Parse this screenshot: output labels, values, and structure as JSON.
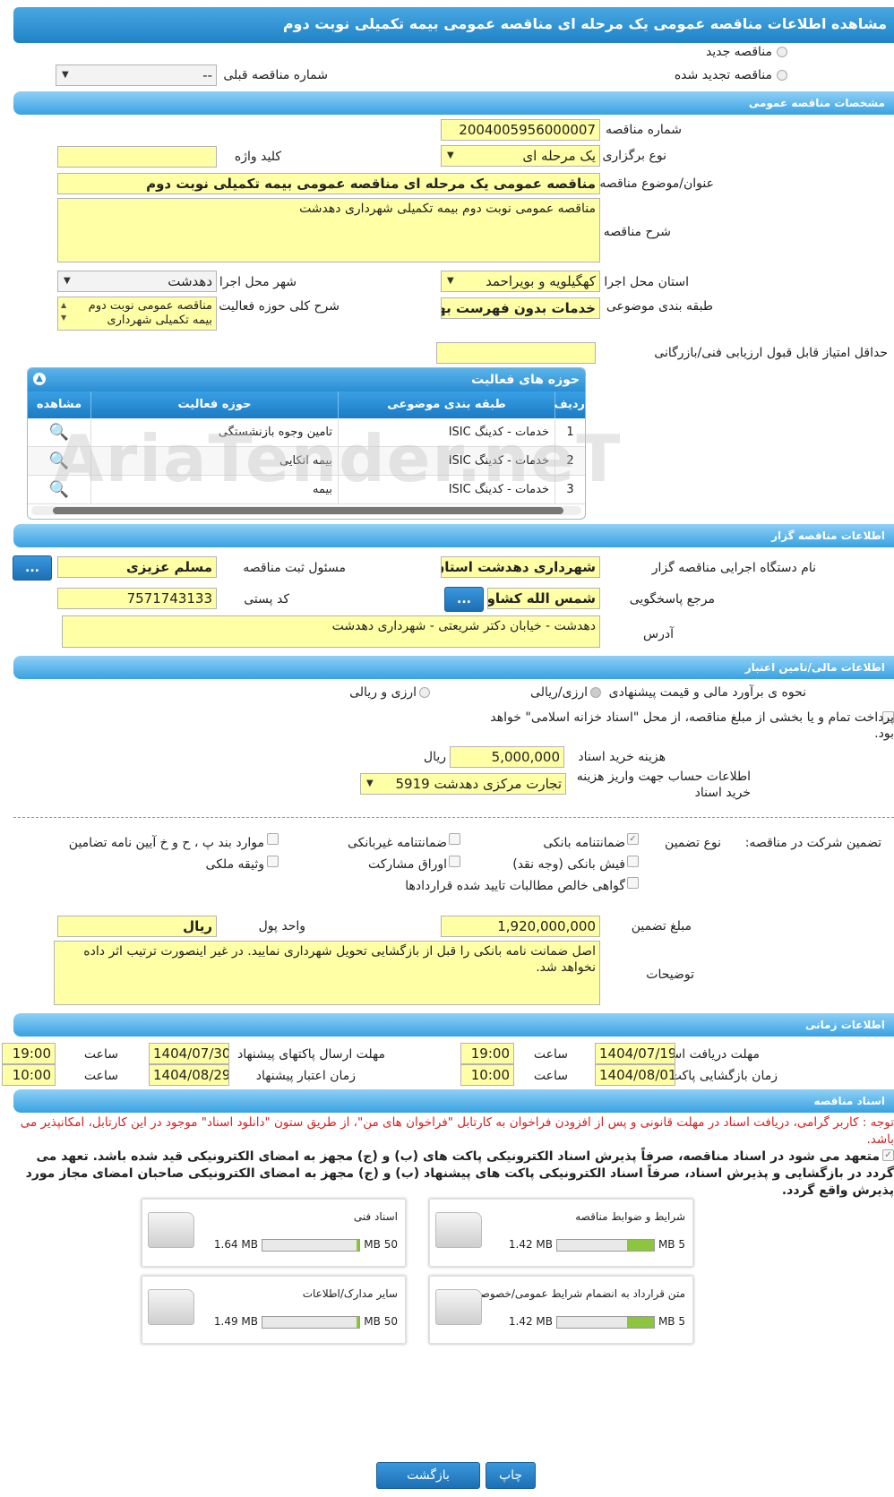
{
  "title": "مشاهده اطلاعات مناقصه عمومی یک مرحله ای مناقصه عمومی بیمه تکمیلی نوبت دوم",
  "top": {
    "new_tender": "مناقصه جدید",
    "renewed_tender": "مناقصه تجدید شده",
    "prev_number_label": "شماره مناقصه قبلی",
    "prev_number_value": "--"
  },
  "sections": {
    "general": "مشخصات مناقصه عمومی",
    "organizer": "اطلاعات مناقصه گزار",
    "finance": "اطلاعات مالی/تامین اعتبار",
    "timing": "اطلاعات زمانی",
    "documents": "اسناد مناقصه"
  },
  "general": {
    "number_label": "شماره مناقصه",
    "number_value": "2004005956000007",
    "type_label": "نوع برگزاری",
    "type_value": "یک مرحله ای",
    "keyword_label": "کلید واژه",
    "keyword_value": "",
    "subject_label": "عنوان/موضوع مناقصه",
    "subject_value": "مناقصه عمومی یک مرحله ای مناقصه عمومی بیمه تکمیلی نوبت دوم",
    "desc_label": "شرح مناقصه",
    "desc_value": "مناقصه عمومی نوبت دوم بیمه تکمیلی شهرداری دهدشت",
    "province_label": "استان محل اجرا",
    "province_value": "کهگیلویه و بویراحمد",
    "city_label": "شهر محل اجرا",
    "city_value": "دهدشت",
    "category_label": "طبقه بندی موضوعی",
    "category_value": "خدمات بدون فهرست بها",
    "activity_desc_label": "شرح کلی حوزه فعالیت",
    "activity_desc_value": "مناقصه عمومی نوبت دوم بیمه تکمیلی شهرداری",
    "min_score_label": "حداقل امتیاز قابل قبول ارزیابی فنی/بازرگانی",
    "min_score_value": ""
  },
  "activity_grid": {
    "title": "حوزه های فعالیت",
    "headers": [
      "ردیف",
      "طبقه بندی موضوعی",
      "حوزه فعالیت",
      "مشاهده"
    ],
    "rows": [
      [
        "1",
        "خدمات - کدینگ ISIC",
        "تامین وجوه بازنشستگی"
      ],
      [
        "2",
        "خدمات - کدینگ ISIC",
        "بیمه اتکایی"
      ],
      [
        "3",
        "خدمات - کدینگ ISIC",
        "بیمه"
      ]
    ]
  },
  "watermark": "AriaTender.neT",
  "organizer": {
    "org_label": "نام دستگاه اجرایی مناقصه گزار",
    "org_value": "شهرداری دهدشت استان کهگیلویه",
    "registrar_label": "مسئول ثبت مناقصه",
    "registrar_value": "مسلم عزیزی",
    "responder_label": "مرجع پاسخگویی",
    "responder_value": "شمس الله کشاورز",
    "postal_label": "کد پستی",
    "postal_value": "7571743133",
    "address_label": "آدرس",
    "address_value": "دهدشت - خیابان دکتر شریعتی - شهرداری دهدشت",
    "more_btn": "..."
  },
  "finance": {
    "estimate_label": "نحوه ی برآورد مالی و قیمت پیشنهادی",
    "rial_opt": "ارزی/ریالی",
    "foreign_opt": "ارزی و ریالی",
    "islamic_text": "پرداخت تمام و یا بخشی از مبلغ مناقصه، از محل \"اسناد خزانه اسلامی\" خواهد بود.",
    "doc_fee_label": "هزینه خرید اسناد",
    "doc_fee_value": "5,000,000",
    "doc_fee_unit": "ریال",
    "account_label": "اطلاعات حساب جهت واریز هزینه خرید اسناد",
    "account_value": "تجارت مرکزی دهدشت 5919",
    "guarantee_label": "تضمین شرکت در مناقصه:",
    "guarantee_type_label": "نوع تضمین",
    "g_bank": "ضمانتنامه بانکی",
    "g_nonbank": "ضمانتنامه غیربانکی",
    "g_items": "موارد بند پ ، ح و خ آیین نامه تضامین",
    "g_cash": "فیش بانکی (وجه نقد)",
    "g_bonds": "اوراق مشارکت",
    "g_property": "وثیقه ملکی",
    "g_receivable": "گواهی خالص مطالبات تایید شده قراردادها",
    "amount_label": "مبلغ تضمین",
    "amount_value": "1,920,000,000",
    "currency_label": "واحد پول",
    "currency_value": "ریال",
    "notes_label": "توضیحات",
    "notes_value": "اصل ضمانت نامه بانکی را قبل از بازگشایی تحویل شهرداری نمایید. در غیر اینصورت ترتیب اثر داده نخواهد شد."
  },
  "timing": {
    "receive_label": "مهلت دریافت اسناد",
    "receive_date": "1404/07/19",
    "receive_time": "19:00",
    "send_label": "مهلت ارسال پاکتهای پیشنهاد",
    "send_date": "1404/07/30",
    "send_time": "19:00",
    "open_label": "زمان بازگشایی پاکت ها",
    "open_date": "1404/08/01",
    "open_time": "10:00",
    "valid_label": "زمان اعتبار پیشنهاد",
    "valid_date": "1404/08/29",
    "valid_time": "10:00",
    "time_label": "ساعت"
  },
  "documents": {
    "notice": "توجه : کاربر گرامی، دریافت اسناد در مهلت قانونی و پس از افزودن فراخوان به کارتابل \"فراخوان های من\"، از طریق ستون \"دانلود اسناد\" موجود در این کارتابل، امکانپذیر می باشد.",
    "commit": "متعهد می شود در اسناد مناقصه، صرفاً پذیرش اسناد الکترونیکی پاکت های (ب) و (ج) مجهز به امضای الکترونیکی قید شده باشد. تعهد می گردد در بازگشایی و پذیرش اسناد، صرفاً اسناد الکترونیکی پاکت های پیشنهاد (ب) و (ج) مجهز به امضای الکترونیکی صاحبان امضای مجاز مورد پذیرش واقع گردد.",
    "files": [
      {
        "name": "شرایط و ضوابط مناقصه",
        "size": "1.42 MB",
        "max": "5 MB",
        "fill": 0.28
      },
      {
        "name": "اسناد فنی",
        "size": "1.64 MB",
        "max": "50 MB",
        "fill": 0.03
      },
      {
        "name": "متن قرارداد به انضمام شرایط عمومی/خصوصی",
        "size": "1.42 MB",
        "max": "5 MB",
        "fill": 0.28
      },
      {
        "name": "سایر مدارک/اطلاعات",
        "size": "1.49 MB",
        "max": "50 MB",
        "fill": 0.03
      }
    ]
  },
  "buttons": {
    "print": "چاپ",
    "back": "بازگشت"
  }
}
